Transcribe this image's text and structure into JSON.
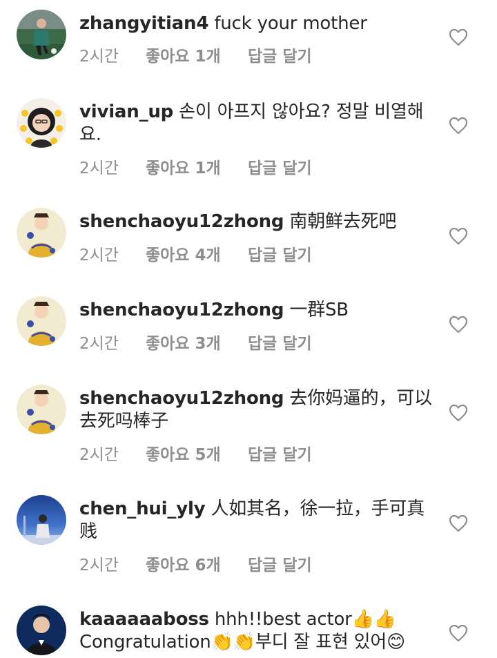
{
  "comments": [
    {
      "username": "zhangyitian4",
      "text": " fuck your mother",
      "time": "2시간",
      "likes": "좋아요 1개",
      "reply": "답글 달기",
      "avatar_icon": "soccer-player-avatar-icon"
    },
    {
      "username": "vivian_up",
      "text": " 손이 아프지 않아요? 정말 비열해요.",
      "time": "2시간",
      "likes": "좋아요 1개",
      "reply": "답글 달기",
      "avatar_icon": "girl-with-emoji-avatar-icon"
    },
    {
      "username": "shenchaoyu12zhong",
      "text": " 南朝鲜去死吧",
      "time": "2시간",
      "likes": "좋아요 4개",
      "reply": "답글 달기",
      "avatar_icon": "emperor-cartoon-avatar-icon"
    },
    {
      "username": "shenchaoyu12zhong",
      "text": " 一群SB",
      "time": "2시간",
      "likes": "좋아요 3개",
      "reply": "답글 달기",
      "avatar_icon": "emperor-cartoon-avatar-icon"
    },
    {
      "username": "shenchaoyu12zhong",
      "text": " 去你妈逼的，可以去死吗棒子",
      "time": "2시간",
      "likes": "좋아요 5개",
      "reply": "답글 달기",
      "avatar_icon": "emperor-cartoon-avatar-icon"
    },
    {
      "username": "chen_hui_yly",
      "text": " 人如其名，徐一拉，手可真贱",
      "time": "2시간",
      "likes": "좋아요 6개",
      "reply": "답글 달기",
      "avatar_icon": "person-night-sky-avatar-icon"
    },
    {
      "username": "kaaaaaaboss",
      "text": " hhh!!best actor👍👍Congratulation👏👏부디 잘 표현 있어😊",
      "time": "",
      "likes": "",
      "reply": "",
      "avatar_icon": "man-in-suit-avatar-icon"
    }
  ],
  "colors": {
    "text": "#262626",
    "meta": "#8e8e8e",
    "heart_stroke": "#8e8e8e",
    "background": "#ffffff"
  }
}
